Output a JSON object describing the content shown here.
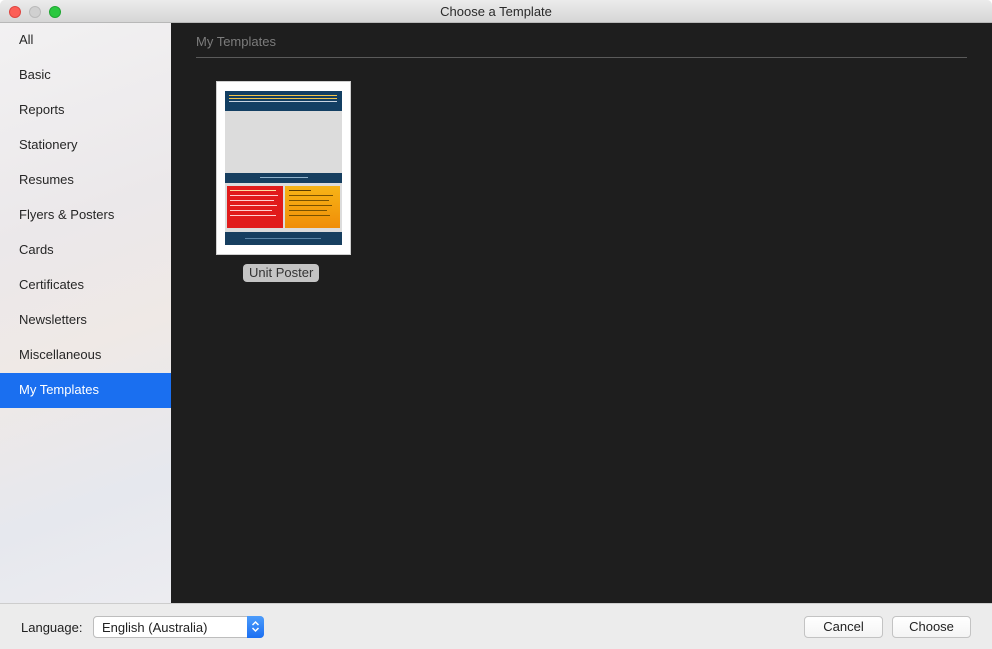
{
  "window": {
    "title": "Choose a Template"
  },
  "sidebar": {
    "items": [
      {
        "label": "All",
        "selected": false
      },
      {
        "label": "Basic",
        "selected": false
      },
      {
        "label": "Reports",
        "selected": false
      },
      {
        "label": "Stationery",
        "selected": false
      },
      {
        "label": "Resumes",
        "selected": false
      },
      {
        "label": "Flyers & Posters",
        "selected": false
      },
      {
        "label": "Cards",
        "selected": false
      },
      {
        "label": "Certificates",
        "selected": false
      },
      {
        "label": "Newsletters",
        "selected": false
      },
      {
        "label": "Miscellaneous",
        "selected": false
      },
      {
        "label": "My Templates",
        "selected": true
      }
    ]
  },
  "main": {
    "section_title": "My Templates",
    "templates": [
      {
        "name": "Unit Poster"
      }
    ]
  },
  "footer": {
    "language_label": "Language:",
    "language_value": "English (Australia)",
    "cancel_label": "Cancel",
    "choose_label": "Choose"
  },
  "colors": {
    "selection": "#1a6ff0",
    "main_background": "#1e1e1e",
    "poster_header": "#133f63",
    "poster_red": "#e11b1b",
    "poster_orange": "#f7b417"
  }
}
